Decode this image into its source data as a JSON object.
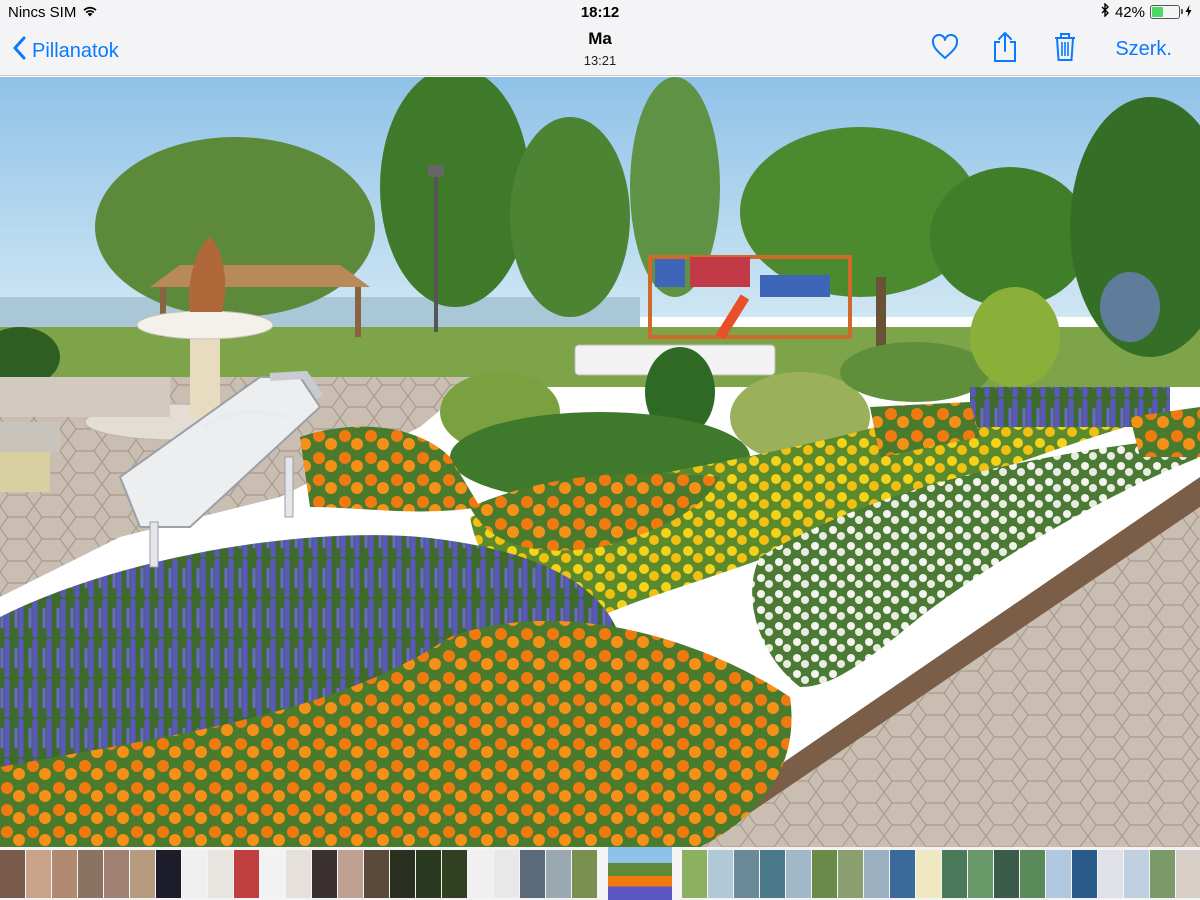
{
  "status": {
    "carrier": "Nincs SIM",
    "time": "18:12",
    "battery": "42%",
    "battery_level": 0.42
  },
  "nav": {
    "back_label": "Pillanatok",
    "title": "Ma",
    "subtitle": "13:21",
    "edit_label": "Szerk."
  },
  "colors": {
    "accent": "#0a7aff"
  },
  "thumbs": [
    "#7a5a4a",
    "#c9a28a",
    "#b08a70",
    "#8a7360",
    "#a08070",
    "#b89a80",
    "#1c1c2a",
    "#f0f0f0",
    "#e8e4e0",
    "#c04040",
    "#f2f2f2",
    "#e6e0da",
    "#3a3030",
    "#c0a090",
    "#5a4a3a",
    "#2a3020",
    "#2a3a20",
    "#304020",
    "#f0f0f0",
    "#e8e8e8",
    "#5a6a7a",
    "#9aa8b0",
    "#7a9050",
    "#8ab060",
    "#b0c8d8",
    "#6a8a9a",
    "#4a7a8a",
    "#a0b8c8",
    "#6a8a4a",
    "#8aa070",
    "#9ab0c0",
    "#3a6a9a",
    "#f0e8c0",
    "#4a7a5a",
    "#6a9a6a",
    "#3a5a4a",
    "#5a8a5a",
    "#b0c8e0",
    "#2a5a8a",
    "#e0e0e8",
    "#c0d0e0",
    "#7a9a6a",
    "#d8d0c8",
    "#3a6a8a"
  ]
}
